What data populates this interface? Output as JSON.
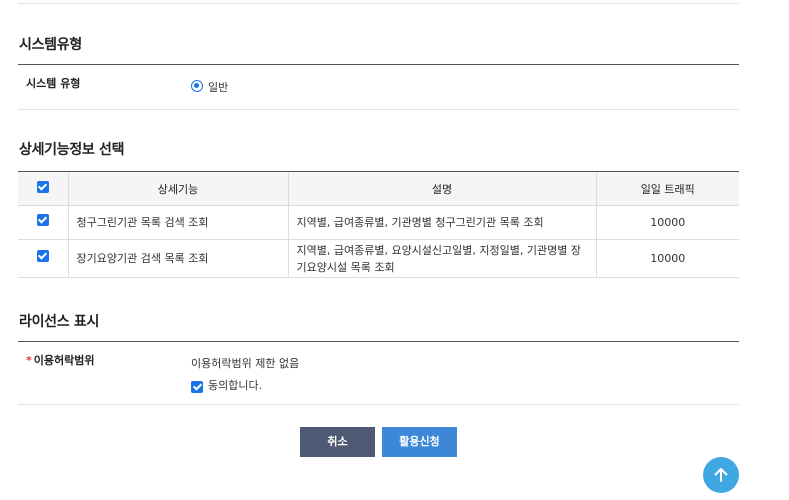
{
  "system_type": {
    "section_title": "시스템유형",
    "label": "시스템 유형",
    "option_label": "일반",
    "selected": true
  },
  "detail": {
    "section_title": "상세기능정보 선택",
    "columns": [
      "상세기능",
      "설명",
      "일일 트래픽"
    ],
    "rows": [
      {
        "name": "청구그린기관 목록 검색 조회",
        "description": "지역별, 급여종류별, 기관명별 청구그린기관 목록 조회",
        "traffic": "10000",
        "checked": true
      },
      {
        "name": "장기요양기관 검색 목록 조회",
        "description": "지역별, 급여종류별, 요양시설신고일별, 지정일별, 기관명별 장기요양시설 목록 조회",
        "traffic": "10000",
        "checked": true
      }
    ]
  },
  "license": {
    "section_title": "라이선스 표시",
    "required_mark": "*",
    "label": "이용허락범위",
    "value": "이용허락범위 제한 없음",
    "agree_label": "동의합니다.",
    "agreed": true
  },
  "buttons": {
    "cancel": "취소",
    "apply": "활용신청"
  },
  "colors": {
    "accent": "#1a73e8",
    "cancel_button": "#4e5a73",
    "apply_button": "#3c87d8",
    "scroll_top_button": "#3fa8e3"
  },
  "icons": {
    "scroll_top": "arrow-up-icon"
  }
}
